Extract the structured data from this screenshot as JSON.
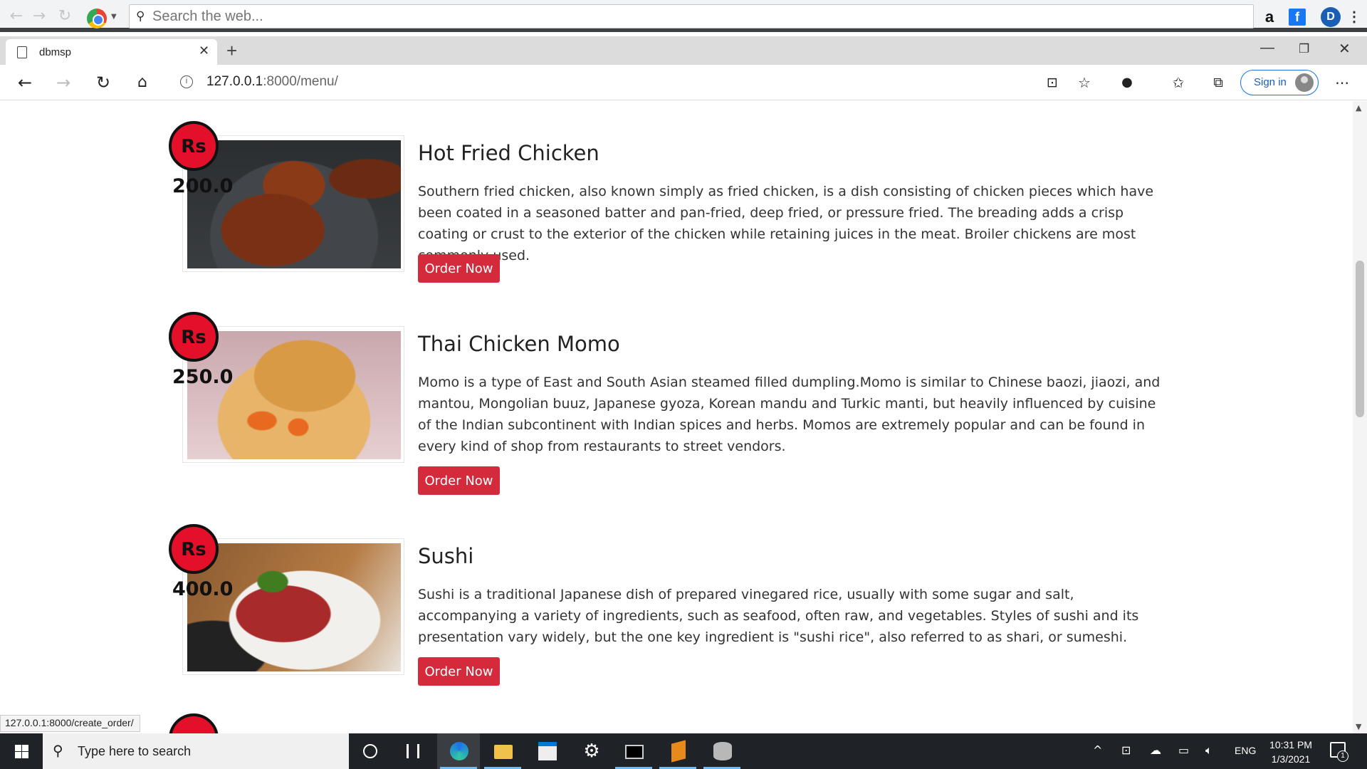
{
  "outer_toolbar": {
    "search_placeholder": "Search the web...",
    "extensions": [
      "amazon-icon",
      "facebook-icon",
      "d-extension-icon"
    ]
  },
  "browser": {
    "tab_title": "dbmsp",
    "url_host": "127.0.0.1",
    "url_rest": ":8000/menu/",
    "sign_in_label": "Sign in",
    "status_url": "127.0.0.1:8000/create_order/"
  },
  "menu": {
    "currency_label": "Rs",
    "order_button_label": "Order Now",
    "items": [
      {
        "title": "Hot Fried Chicken",
        "price": "200.0",
        "image": "fried-chicken-photo",
        "description": "Southern fried chicken, also known simply as fried chicken, is a dish consisting of chicken pieces which have been coated in a seasoned batter and pan-fried, deep fried, or pressure fried. The breading adds a crisp coating or crust to the exterior of the chicken while retaining juices in the meat. Broiler chickens are most commonly used."
      },
      {
        "title": "Thai Chicken Momo",
        "price": "250.0",
        "image": "momo-photo",
        "description": "Momo is a type of East and South Asian steamed filled dumpling.Momo is similar to Chinese baozi, jiaozi, and mantou, Mongolian buuz, Japanese gyoza, Korean mandu and Turkic manti, but heavily influenced by cuisine of the Indian subcontinent with Indian spices and herbs. Momos are extremely popular and can be found in every kind of shop from restaurants to street vendors."
      },
      {
        "title": "Sushi",
        "price": "400.0",
        "image": "raw-meat-photo",
        "description": "Sushi is a traditional Japanese dish of prepared vinegared rice, usually with some sugar and salt, accompanying a variety of ingredients, such as seafood, often raw, and vegetables. Styles of sushi and its presentation vary widely, but the one key ingredient is \"sushi rice\", also referred to as shari, or sumeshi."
      }
    ]
  },
  "taskbar": {
    "search_placeholder": "Type here to search",
    "language": "ENG",
    "time": "10:31 PM",
    "date": "1/3/2021",
    "notification_count": "1"
  },
  "colors": {
    "accent_red": "#d42a3b",
    "badge_red": "#e4102a",
    "edge_blue": "#1a73e8"
  }
}
